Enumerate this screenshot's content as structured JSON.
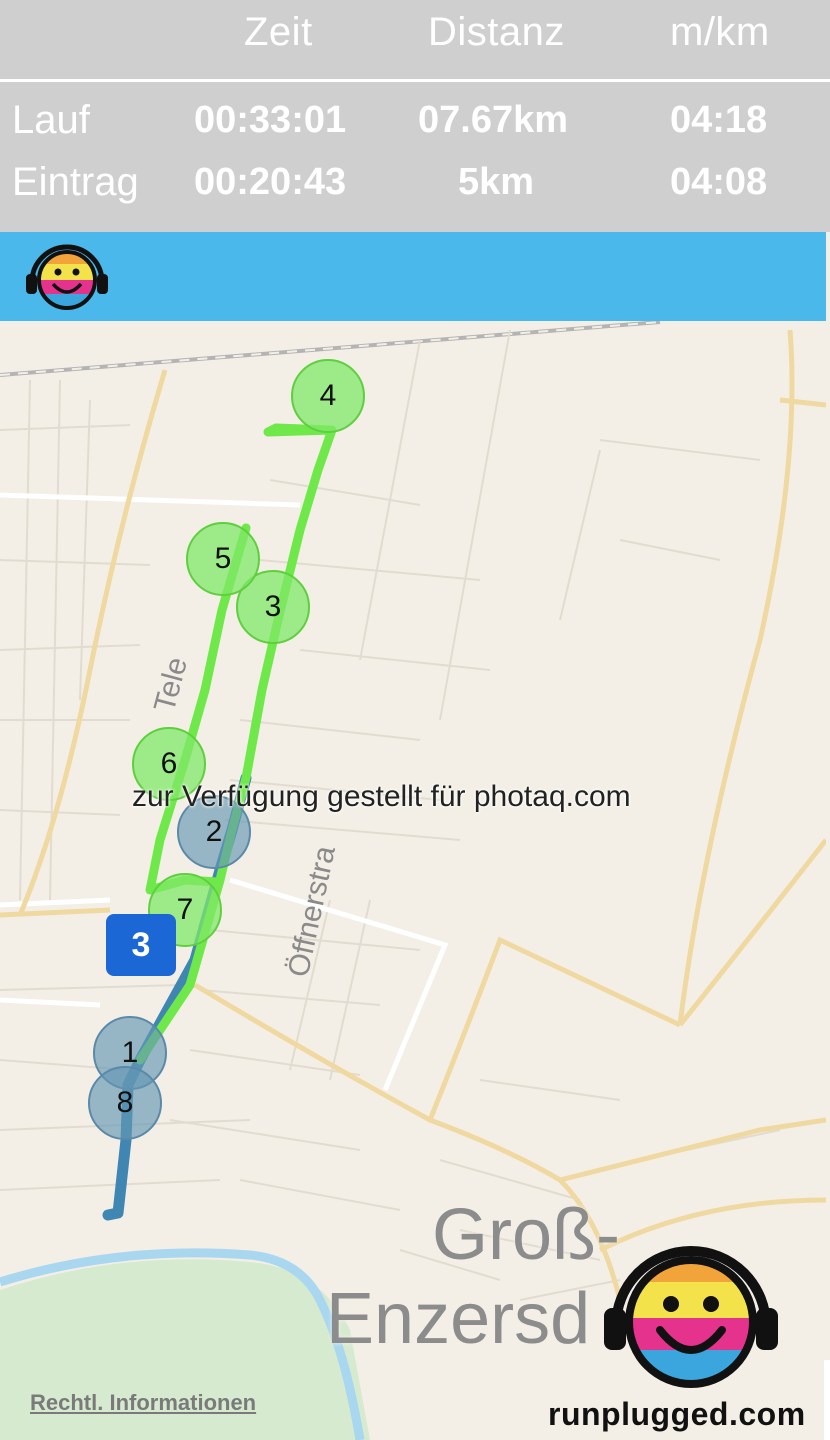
{
  "stats": {
    "headers": [
      "Zeit",
      "Distanz",
      "m/km"
    ],
    "rows": [
      {
        "label": "Lauf",
        "time": "00:33:01",
        "distance": "07.67km",
        "pace": "04:18"
      },
      {
        "label": "Eintrag",
        "time": "00:20:43",
        "distance": "5km",
        "pace": "04:08"
      }
    ]
  },
  "map": {
    "town_line1": "Groß-",
    "town_line2": "Enzersd",
    "street_left": "Tele",
    "street_mid": "Öffnerstra",
    "km_markers_green": [
      "3",
      "4",
      "5",
      "6",
      "7"
    ],
    "km_markers_blue": [
      "1",
      "2",
      "8"
    ],
    "badge": "3",
    "route_colors": {
      "green": "#6fe84a",
      "blue": "#3f86b3"
    }
  },
  "watermark": "zur Verfügung gestellt für photaq.com",
  "footer": {
    "legal_link": "Rechtl. Informationen",
    "brand": "runplugged.com"
  },
  "logo": {
    "name": "runplugged-smiley-icon",
    "colors": [
      "#f2a43b",
      "#f4e24b",
      "#e5328c",
      "#3aa6dd"
    ]
  }
}
